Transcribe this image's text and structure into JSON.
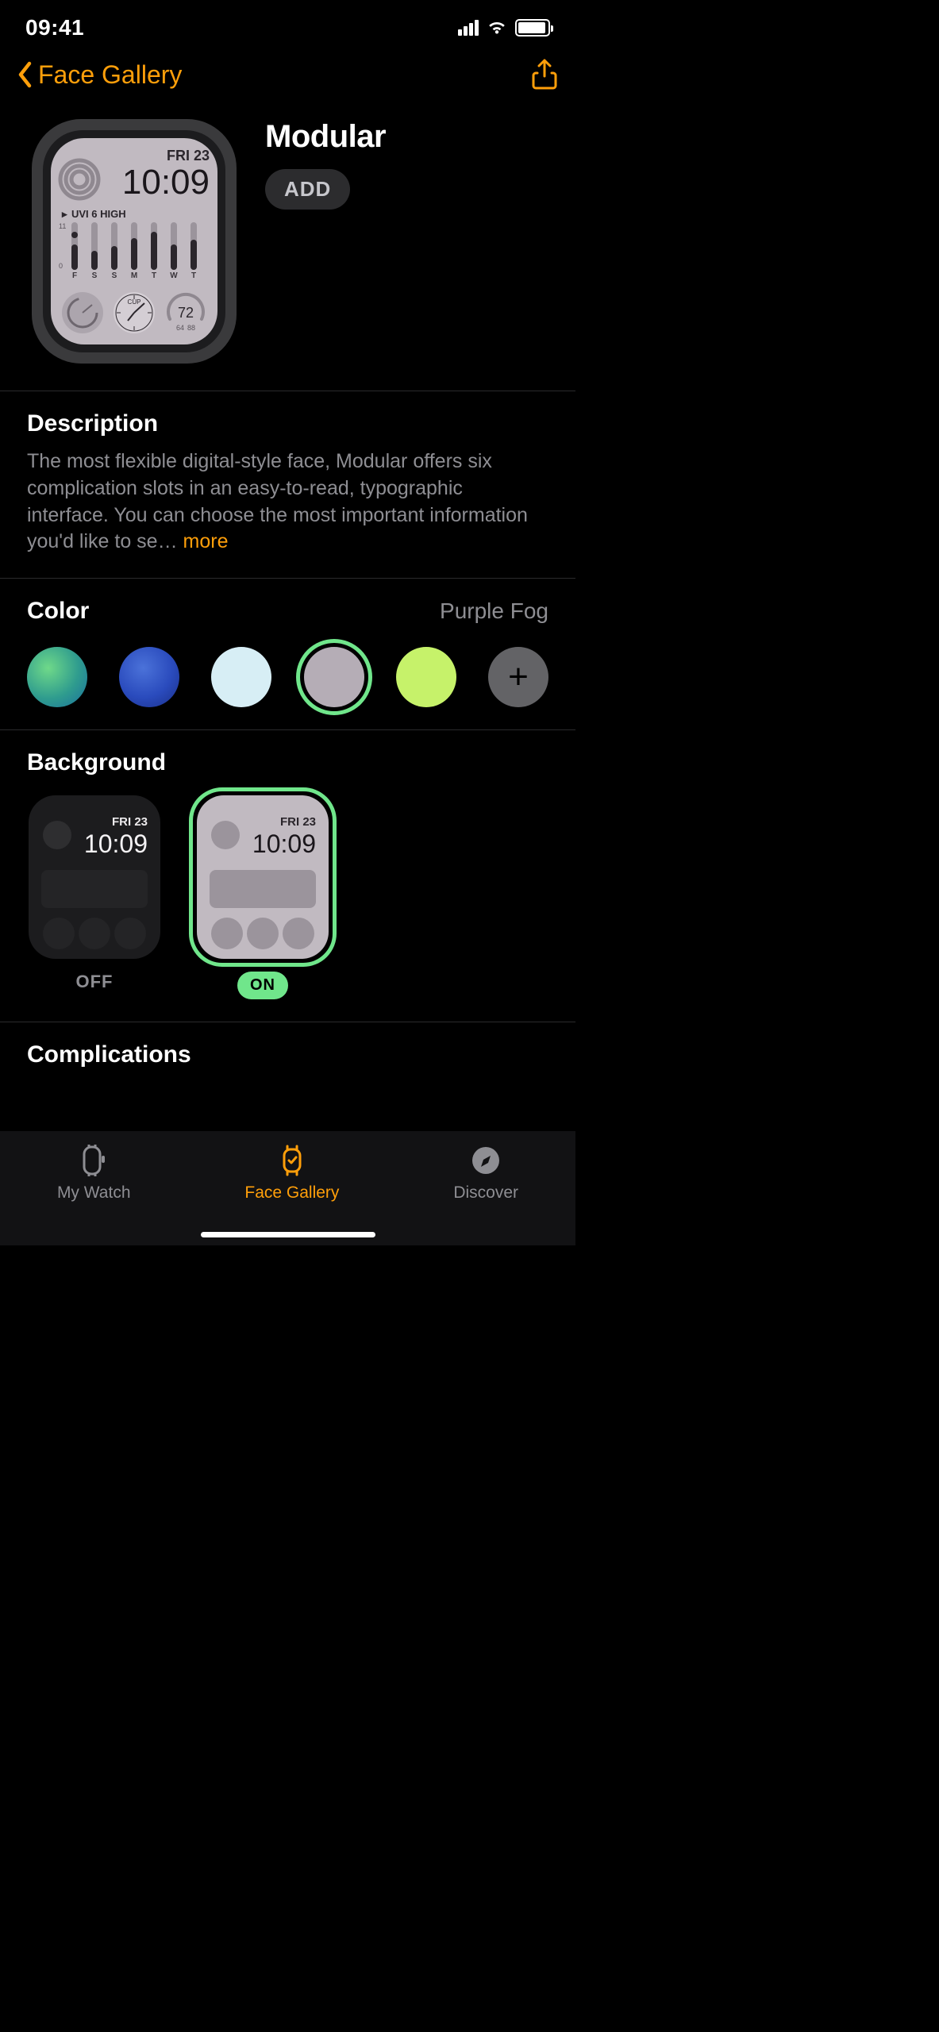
{
  "status": {
    "time": "09:41"
  },
  "nav": {
    "back_label": "Face Gallery"
  },
  "hero": {
    "title": "Modular",
    "add_label": "ADD",
    "preview": {
      "day": "FRI 23",
      "time": "10:09",
      "uvi_label": "UVI 6 HIGH",
      "scale_top": "11",
      "scale_bottom": "0",
      "week_days": [
        "F",
        "S",
        "S",
        "M",
        "T",
        "W",
        "T"
      ],
      "cup_label": "CUP",
      "temp": "72",
      "temp_lo": "64",
      "temp_hi": "88"
    }
  },
  "description": {
    "heading": "Description",
    "text": "The most flexible digital-style face, Modular offers six complication slots in an easy-to-read, typographic interface. You can choose the most important information you'd like to se…",
    "more": " more"
  },
  "color": {
    "heading": "Color",
    "selected_label": "Purple Fog",
    "options": [
      {
        "name": "green-gradient",
        "css": "radial-gradient(circle at 35% 35%, #6fd989 0%, #2f9c8e 55%, #1a6f9e 100%)",
        "selected": false
      },
      {
        "name": "blue",
        "css": "radial-gradient(circle at 40% 35%, #4b72d9 0%, #2a4bbd 55%, #1a2f87 100%)",
        "selected": false
      },
      {
        "name": "light-blue",
        "css": "#d7eef5",
        "selected": false
      },
      {
        "name": "purple-fog",
        "css": "#b5adb6",
        "selected": true
      },
      {
        "name": "lime",
        "css": "#c6f26a",
        "selected": false
      }
    ]
  },
  "background": {
    "heading": "Background",
    "options": [
      {
        "name": "off",
        "label": "OFF",
        "selected": false
      },
      {
        "name": "on",
        "label": "ON",
        "selected": true
      }
    ],
    "preview": {
      "day": "FRI 23",
      "time": "10:09"
    }
  },
  "complications": {
    "heading": "Complications"
  },
  "tabs": {
    "my_watch": "My Watch",
    "face_gallery": "Face Gallery",
    "discover": "Discover"
  }
}
